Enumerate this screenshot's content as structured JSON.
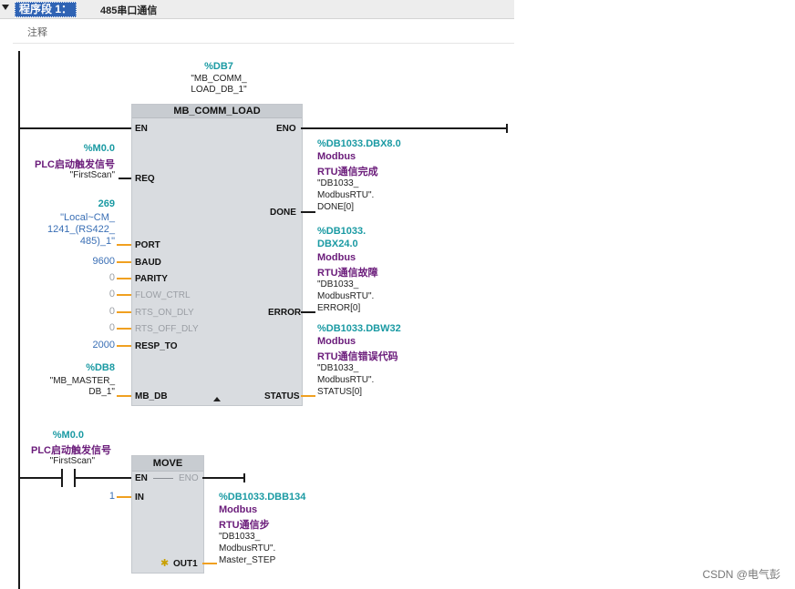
{
  "network": {
    "segment_label": "程序段 1：",
    "segment_title": "485串口通信",
    "comment": "注释"
  },
  "comm_load": {
    "instance_address": "%DB7",
    "instance_name_line1": "\"MB_COMM_",
    "instance_name_line2": "LOAD_DB_1\"",
    "title": "MB_COMM_LOAD",
    "pins": {
      "en": "EN",
      "eno": "ENO",
      "req": "REQ",
      "done": "DONE",
      "port": "PORT",
      "baud": "BAUD",
      "parity": "PARITY",
      "flow_ctrl": "FLOW_CTRL",
      "rts_on_dly": "RTS_ON_DLY",
      "rts_off_dly": "RTS_OFF_DLY",
      "resp_to": "RESP_TO",
      "error": "ERROR",
      "mb_db": "MB_DB",
      "status": "STATUS"
    },
    "req_input": {
      "address": "%M0.0",
      "symbol": "PLC启动触发信号",
      "name": "\"FirstScan\""
    },
    "port_input": {
      "value": "269",
      "line1": "\"Local~CM_",
      "line2": "1241_(RS422_",
      "line3": "485)_1\""
    },
    "baud_value": "9600",
    "parity_value": "0",
    "flow_ctrl_value": "0",
    "rts_on_dly_value": "0",
    "rts_off_dly_value": "0",
    "resp_to_value": "2000",
    "mb_db_input": {
      "address": "%DB8",
      "line1": "\"MB_MASTER_",
      "line2": "DB_1\""
    },
    "done_output": {
      "address": "%DB1033.DBX8.0",
      "sym1": "Modbus",
      "sym2": "RTU通信完成",
      "q1": "\"DB1033_",
      "q2": "ModbusRTU\".",
      "q3": "DONE[0]"
    },
    "error_output": {
      "address1": "%DB1033.",
      "address2": "DBX24.0",
      "sym1": "Modbus",
      "sym2": "RTU通信故障",
      "q1": "\"DB1033_",
      "q2": "ModbusRTU\".",
      "q3": "ERROR[0]"
    },
    "status_output": {
      "address": "%DB1033.DBW32",
      "sym1": "Modbus",
      "sym2": "RTU通信错误代码",
      "q1": "\"DB1033_",
      "q2": "ModbusRTU\".",
      "q3": "STATUS[0]"
    }
  },
  "move": {
    "contact": {
      "address": "%M0.0",
      "symbol": "PLC启动触发信号",
      "name": "\"FirstScan\""
    },
    "title": "MOVE",
    "en": "EN",
    "eno": "ENO",
    "in": "IN",
    "out1": "OUT1",
    "in_value": "1",
    "output": {
      "address": "%DB1033.DBB134",
      "sym1": "Modbus",
      "sym2": "RTU通信步",
      "q1": "\"DB1033_",
      "q2": "ModbusRTU\".",
      "q3": "Master_STEP"
    }
  },
  "watermark": "CSDN @电气彭"
}
